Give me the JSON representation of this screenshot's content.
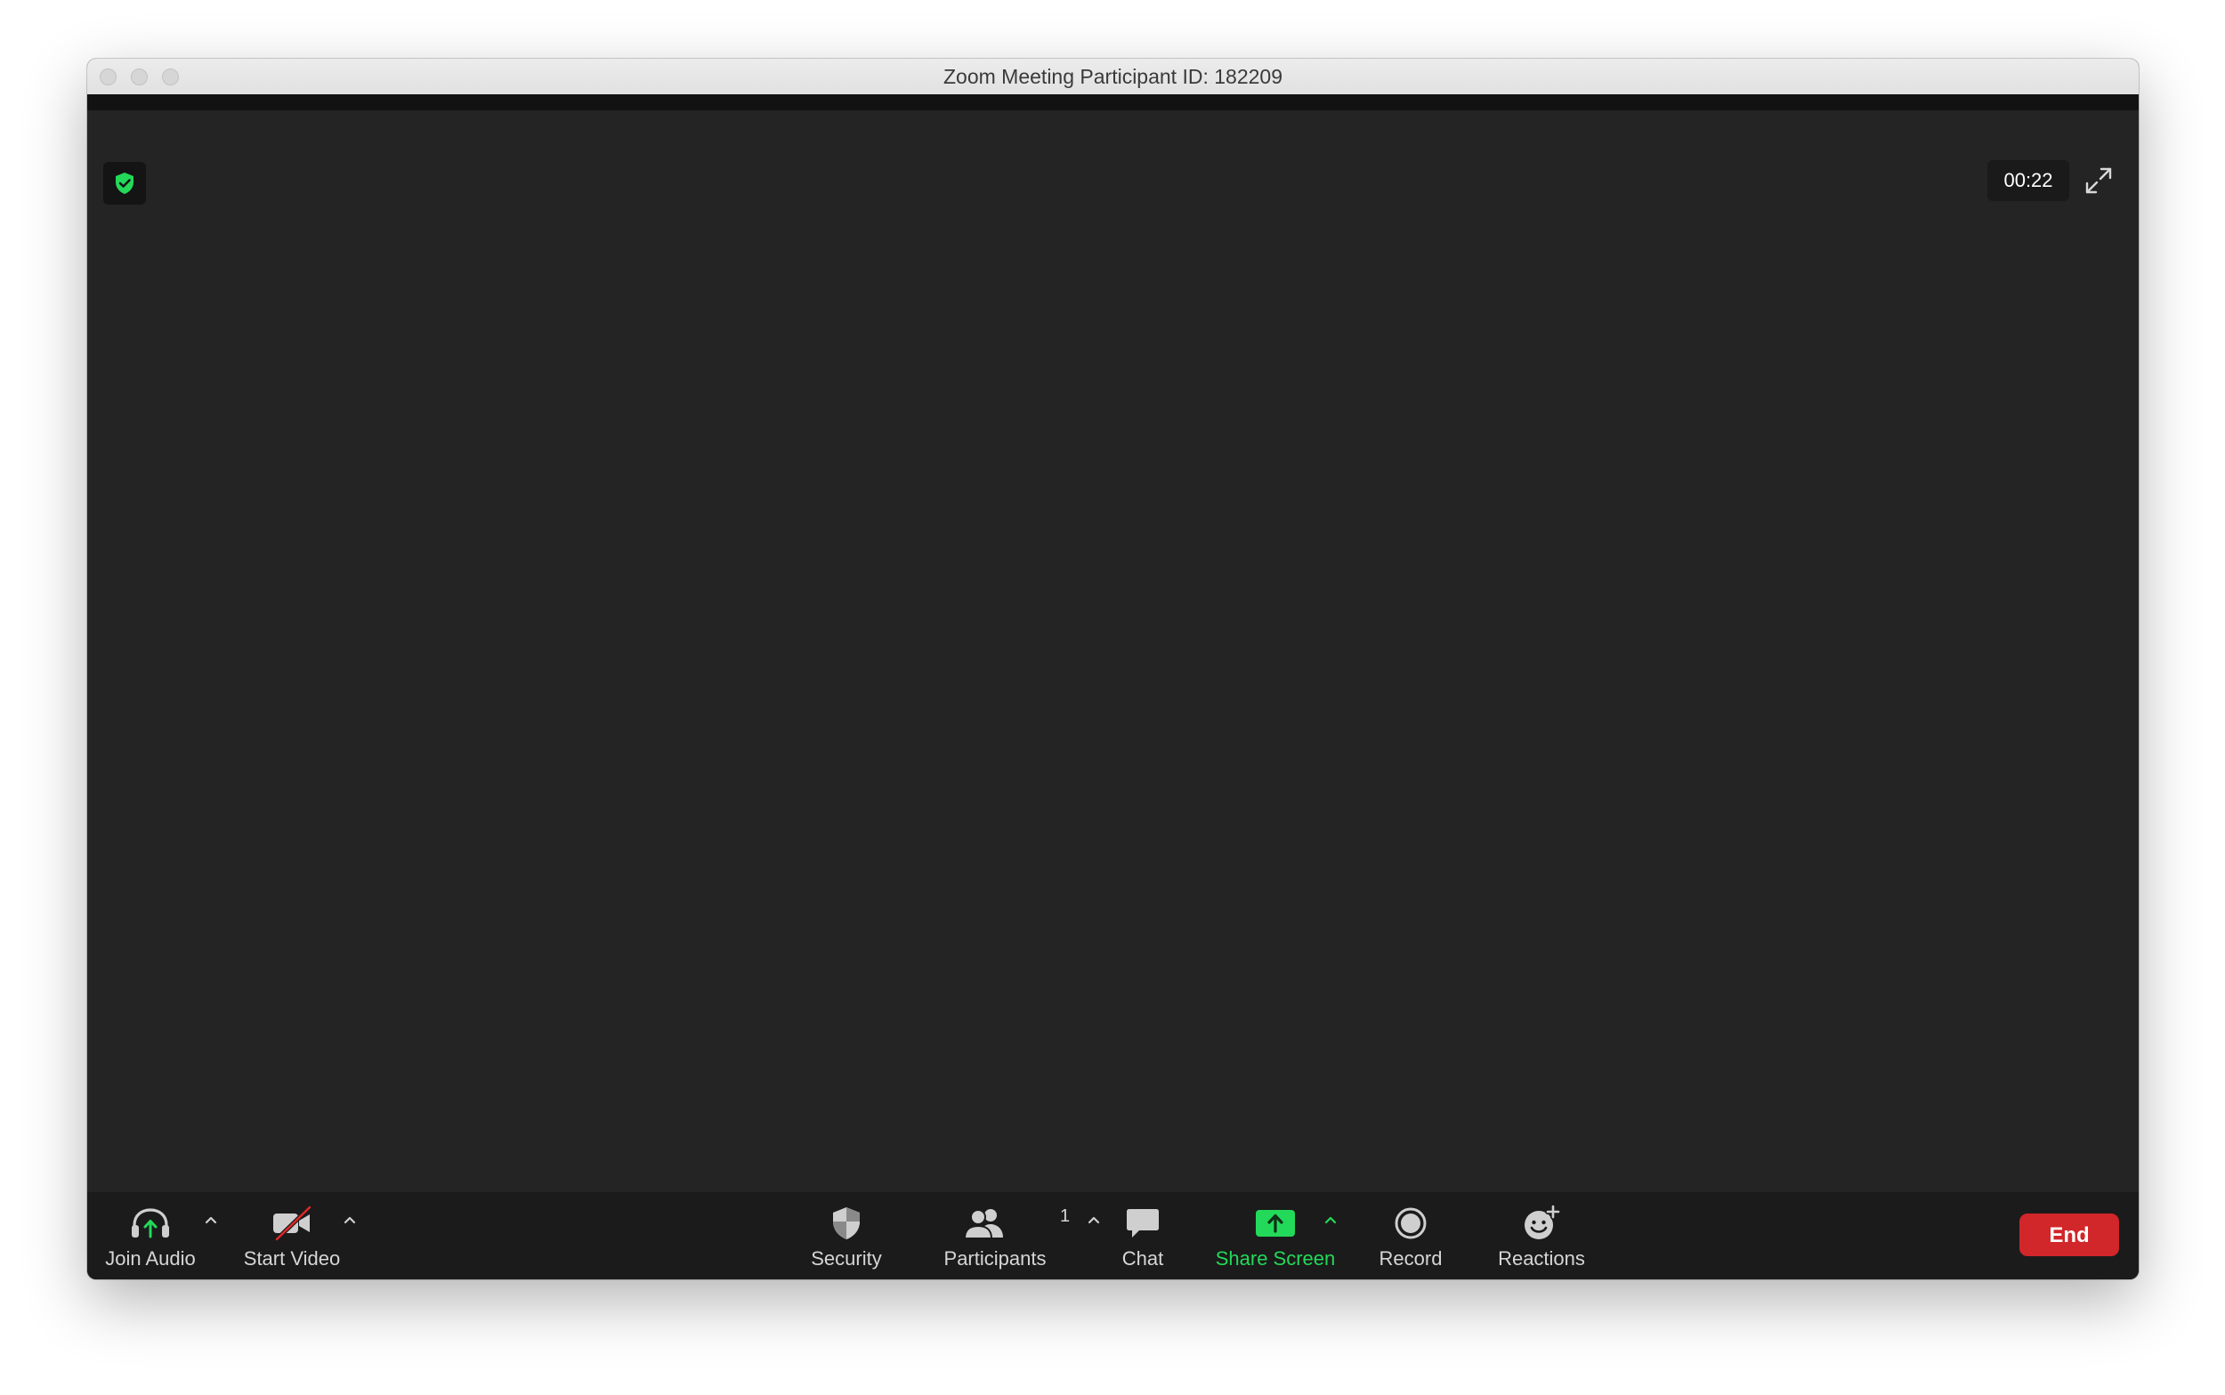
{
  "window": {
    "title": "Zoom Meeting Participant ID: 182209"
  },
  "meeting": {
    "elapsed": "00:22",
    "participant_count": "1"
  },
  "toolbar": {
    "join_audio_label": "Join Audio",
    "start_video_label": "Start Video",
    "security_label": "Security",
    "participants_label": "Participants",
    "chat_label": "Chat",
    "share_screen_label": "Share Screen",
    "record_label": "Record",
    "reactions_label": "Reactions",
    "end_label": "End"
  },
  "icons": {
    "encryption": "shield-check-icon",
    "fullscreen": "expand-icon",
    "join_audio": "headphones-icon",
    "start_video": "video-off-icon",
    "security": "shield-icon",
    "participants": "people-icon",
    "chat": "chat-bubble-icon",
    "share_screen": "share-arrow-icon",
    "record": "record-icon",
    "reactions": "smiley-add-icon",
    "menu": "chevron-up-icon"
  },
  "colors": {
    "accent_green": "#23d959",
    "end_red": "#d1262a",
    "stage": "#242424",
    "toolbar": "#1b1b1b",
    "video_off_slash": "#e02828"
  }
}
